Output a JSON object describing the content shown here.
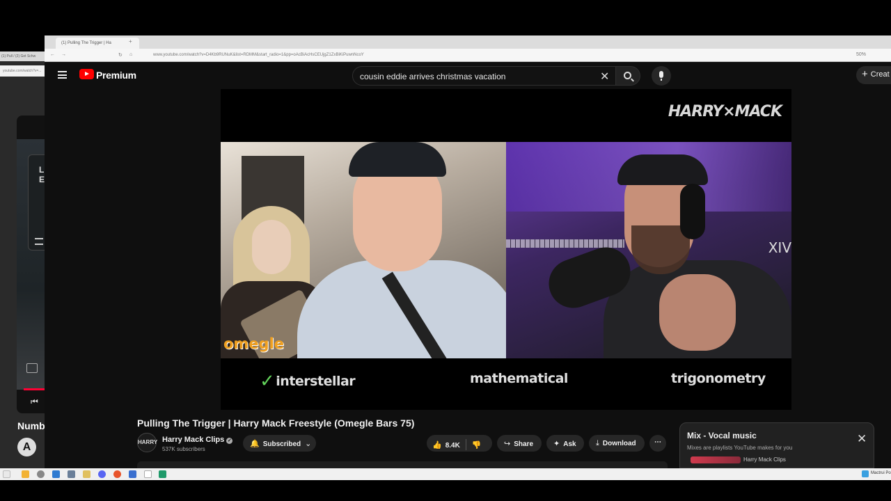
{
  "background_window": {
    "tab_text": "(1) Pull / (2) Get Schw",
    "address": "youtube.com/watch?v=...",
    "card_text": "L E",
    "title": "Numb",
    "avatar_glyph": "A"
  },
  "browser": {
    "tab_title": "(1) Pulling The Trigger | Ha",
    "tab_plus": "+",
    "address": "www.youtube.com/watch?v=D4Kb9RUNuK&list=RDMM&start_radio=1&pp=oAcBiAcHsCEUjgZ1ZxBiKiPuwnNcoY",
    "zoom": "50%"
  },
  "header": {
    "brand": "Premium",
    "search_value": "cousin eddie arrives christmas vacation",
    "create_label": "Creat"
  },
  "video": {
    "logo_text": "HARRY×MACK",
    "overlay_left": "omegle",
    "overlay_right": "XIV",
    "words": [
      "interstellar",
      "mathematical",
      "trigonometry"
    ],
    "word_check": "✓"
  },
  "below": {
    "title": "Pulling The Trigger | Harry Mack Freestyle (Omegle Bars 75)",
    "channel_avatar": "HARRY",
    "channel_name": "Harry Mack Clips",
    "subscribers": "537K subscribers",
    "subscribed_label": "Subscribed",
    "like_count": "8.4K",
    "share_label": "Share",
    "ask_label": "Ask",
    "download_label": "Download",
    "more_label": "⋯"
  },
  "mix": {
    "title": "Mix - Vocal music",
    "subtitle": "Mixes are playlists YouTube makes for you",
    "channel": "Harry Mack Clips",
    "close": "✕"
  },
  "taskbar": {
    "right_label": "Mactrui Po"
  }
}
